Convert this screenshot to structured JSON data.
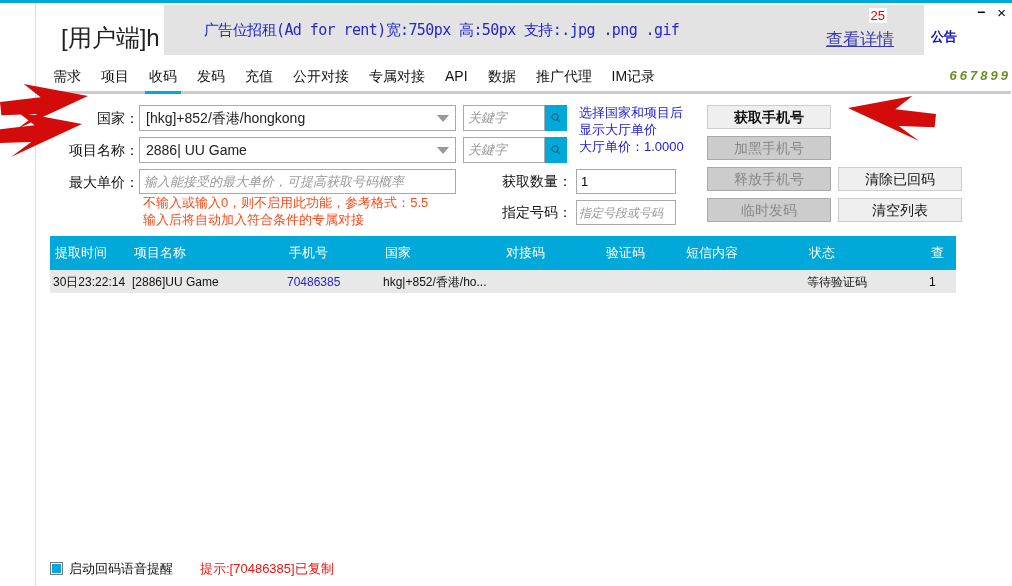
{
  "window": {
    "title": "[用户端]h",
    "minimize": "−",
    "close": "×"
  },
  "ad": {
    "text": "广告位招租(Ad for rent)宽:750px 高:50px 支持:.jpg .png .gif",
    "badge": "25",
    "link": "查看详情"
  },
  "notice": "公告",
  "tabs": [
    {
      "label": "需求",
      "selected": false
    },
    {
      "label": "项目",
      "selected": false
    },
    {
      "label": "收码",
      "selected": true
    },
    {
      "label": "发码",
      "selected": false
    },
    {
      "label": "充值",
      "selected": false
    },
    {
      "label": "公开对接",
      "selected": false
    },
    {
      "label": "专属对接",
      "selected": false
    },
    {
      "label": "API",
      "selected": false
    },
    {
      "label": "数据",
      "selected": false
    },
    {
      "label": "推广代理",
      "selected": false
    },
    {
      "label": "IM记录",
      "selected": false
    }
  ],
  "user_code": "667899",
  "form": {
    "country": {
      "label": "国家：",
      "value": "[hkg]+852/香港/hongkong",
      "search_placeholder": "关鍵字"
    },
    "project": {
      "label": "项目名称：",
      "value": "2886| UU Game",
      "search_placeholder": "关鍵字"
    },
    "max_price": {
      "label": "最大单价：",
      "placeholder": "输入能接受的最大单价，可提高获取号码概率",
      "hints": [
        "不输入或输入0，则不启用此功能，参考格式：5.5",
        "输入后将自动加入符合条件的专属对接"
      ]
    },
    "info": [
      "选择国家和项目后",
      "显示大厅单价",
      "大厅单价：1.0000"
    ],
    "quantity": {
      "label": "获取数量：",
      "value": "1"
    },
    "number": {
      "label": "指定号码：",
      "placeholder": "指定号段或号码"
    }
  },
  "buttons": [
    {
      "label": "获取手机号",
      "disabled": false,
      "primary": true
    },
    {
      "label": "加黑手机号",
      "disabled": true,
      "primary": false
    },
    {
      "label": "释放手机号",
      "disabled": true,
      "primary": false
    },
    {
      "label": "清除已回码",
      "disabled": false,
      "primary": false
    },
    {
      "label": "临时发码",
      "disabled": true,
      "primary": false
    },
    {
      "label": "清空列表",
      "disabled": false,
      "primary": false
    }
  ],
  "table": {
    "columns": [
      "提取时间",
      "项目名称",
      "手机号",
      "国家",
      "对接码",
      "验证码",
      "短信内容",
      "状态",
      "查"
    ],
    "rows": [
      [
        "30日23:22:14",
        "[2886]UU Game",
        "70486385",
        "hkg|+852/香港/ho...",
        "",
        "",
        "",
        "等待验证码",
        "1"
      ]
    ]
  },
  "footer": {
    "voice_alert": {
      "label": "启动回码语音提醒",
      "checked": true
    },
    "message": "提示:[70486385]已复制"
  }
}
